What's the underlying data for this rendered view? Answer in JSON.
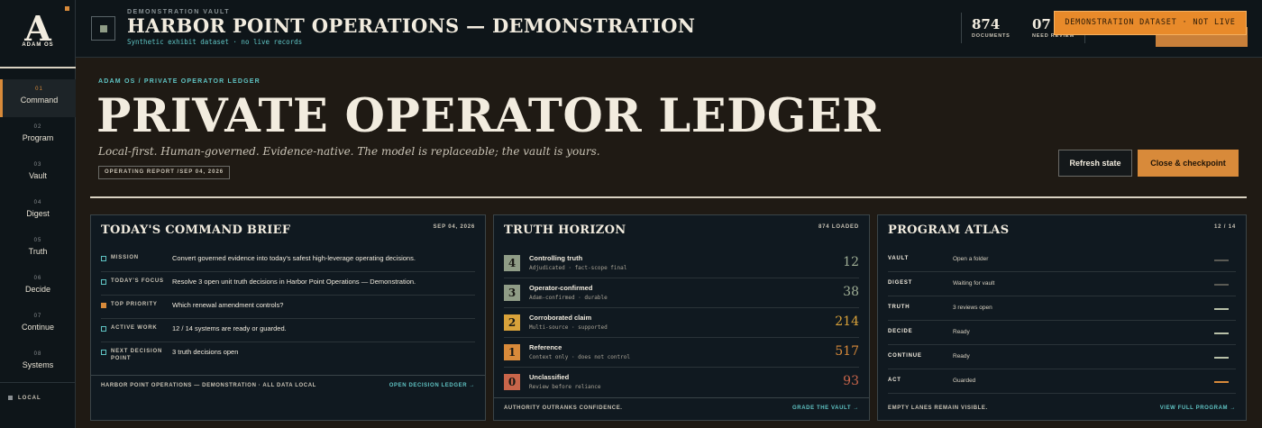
{
  "logo": {
    "letter": "A",
    "name": "ADAM OS"
  },
  "nav": [
    {
      "num": "01",
      "label": "Command",
      "active": true
    },
    {
      "num": "02",
      "label": "Program"
    },
    {
      "num": "03",
      "label": "Vault"
    },
    {
      "num": "04",
      "label": "Digest"
    },
    {
      "num": "05",
      "label": "Truth"
    },
    {
      "num": "06",
      "label": "Decide"
    },
    {
      "num": "07",
      "label": "Continue"
    },
    {
      "num": "08",
      "label": "Systems"
    }
  ],
  "sidebar_footer": "LOCAL",
  "topbar": {
    "kicker": "DEMONSTRATION VAULT",
    "title": "HARBOR POINT OPERATIONS — DEMONSTRATION",
    "subtitle": "Synthetic exhibit dataset · no live records",
    "stats": [
      {
        "value": "874",
        "label": "DOCUMENTS"
      },
      {
        "value": "07",
        "label": "NEED REVIEW"
      }
    ],
    "banner": "DEMONSTRATION DATASET · NOT LIVE"
  },
  "hero": {
    "kicker": "ADAM OS / PRIVATE OPERATOR LEDGER",
    "title": "PRIVATE OPERATOR LEDGER",
    "tagline": "Local-first. Human-governed. Evidence-native. The model is replaceable; the vault is yours.",
    "report": "OPERATING REPORT /SEP 04, 2026",
    "refresh_label": "Refresh state",
    "checkpoint_label": "Close & checkpoint"
  },
  "brief": {
    "title": "TODAY'S COMMAND BRIEF",
    "date": "SEP 04, 2026",
    "rows": [
      {
        "label": "MISSION",
        "text": "Convert governed evidence into today's safest high-leverage operating decisions."
      },
      {
        "label": "TODAY'S FOCUS",
        "text": "Resolve 3 open unit truth decisions in Harbor Point Operations — Demonstration."
      },
      {
        "label": "TOP PRIORITY",
        "text": "Which renewal amendment controls?"
      },
      {
        "label": "ACTIVE WORK",
        "text": "12 / 14 systems are ready or guarded."
      },
      {
        "label": "NEXT DECISION POINT",
        "text": "3 truth decisions open"
      }
    ],
    "footer_left": "HARBOR POINT OPERATIONS — DEMONSTRATION · ALL DATA LOCAL",
    "footer_link": "OPEN DECISION LEDGER →"
  },
  "truth": {
    "title": "TRUTH HORIZON",
    "meta": "874 LOADED",
    "rows": [
      {
        "tier": "4",
        "name": "Controlling truth",
        "desc": "Adjudicated · fact-scope final",
        "value": "12",
        "color": "#8f9c86",
        "value_color": "#9fae95"
      },
      {
        "tier": "3",
        "name": "Operator-confirmed",
        "desc": "Adam-confirmed · durable",
        "value": "38",
        "color": "#8f9c86",
        "value_color": "#9fae95"
      },
      {
        "tier": "2",
        "name": "Corroborated claim",
        "desc": "Multi-source · supported",
        "value": "214",
        "color": "#d9a23a",
        "value_color": "#d9a23a"
      },
      {
        "tier": "1",
        "name": "Reference",
        "desc": "Context only · does not control",
        "value": "517",
        "color": "#d88a3a",
        "value_color": "#d88a3a"
      },
      {
        "tier": "0",
        "name": "Unclassified",
        "desc": "Review before reliance",
        "value": "93",
        "color": "#c8654a",
        "value_color": "#c8654a"
      }
    ],
    "footer_left": "AUTHORITY OUTRANKS CONFIDENCE.",
    "footer_link": "GRADE THE VAULT →"
  },
  "atlas": {
    "title": "PROGRAM ATLAS",
    "meta": "12 / 14",
    "rows": [
      {
        "key": "VAULT",
        "value": "Open a folder",
        "color": "#5a5a54"
      },
      {
        "key": "DIGEST",
        "value": "Waiting for vault",
        "color": "#5a5a54"
      },
      {
        "key": "TRUTH",
        "value": "3 reviews open",
        "color": "#b8c0a8"
      },
      {
        "key": "DECIDE",
        "value": "Ready",
        "color": "#b8c0a8"
      },
      {
        "key": "CONTINUE",
        "value": "Ready",
        "color": "#b8c0a8"
      },
      {
        "key": "ACT",
        "value": "Guarded",
        "color": "#d88a3a"
      }
    ],
    "footer_left": "EMPTY LANES REMAIN VISIBLE.",
    "footer_link": "VIEW FULL PROGRAM →"
  }
}
